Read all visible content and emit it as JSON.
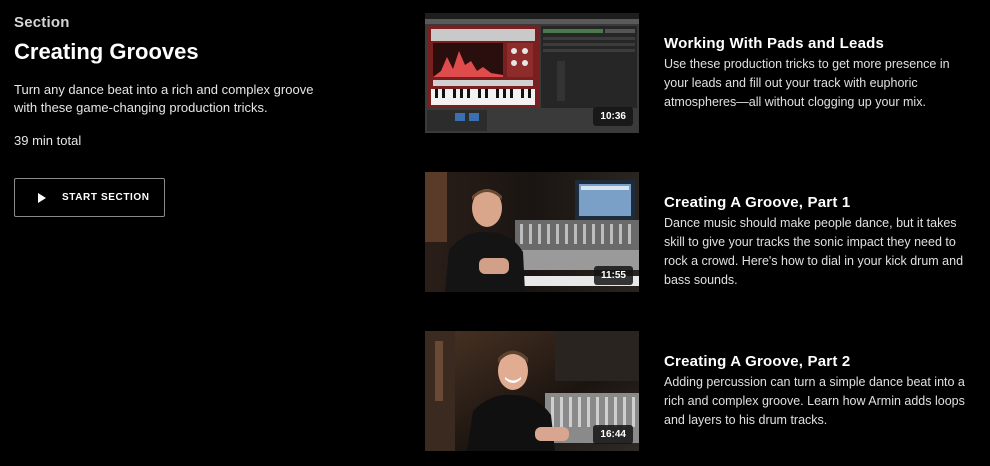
{
  "section": {
    "eyebrow": "Section",
    "title": "Creating Grooves",
    "description": "Turn any dance beat into a rich and complex groove with these game-changing production tricks.",
    "total": "39 min total",
    "start_label": "START SECTION"
  },
  "lessons": [
    {
      "title": "Working With Pads and Leads",
      "description": "Use these production tricks to get more presence in your leads and fill out your track with euphoric atmospheres—all without clogging up your mix.",
      "duration": "10:36"
    },
    {
      "title": "Creating A Groove, Part 1",
      "description": "Dance music should make people dance, but it takes skill to give your tracks the sonic impact they need to rock a crowd. Here's how to dial in your kick drum and bass sounds.",
      "duration": "11:55"
    },
    {
      "title": "Creating A Groove, Part 2",
      "description": "Adding percussion can turn a simple dance beat into a rich and complex groove. Learn how Armin adds loops and layers to his drum tracks.",
      "duration": "16:44"
    }
  ],
  "colors": {
    "background": "#000000",
    "plugin_red": "#b43a3a",
    "button_border": "#8a8a8a"
  }
}
